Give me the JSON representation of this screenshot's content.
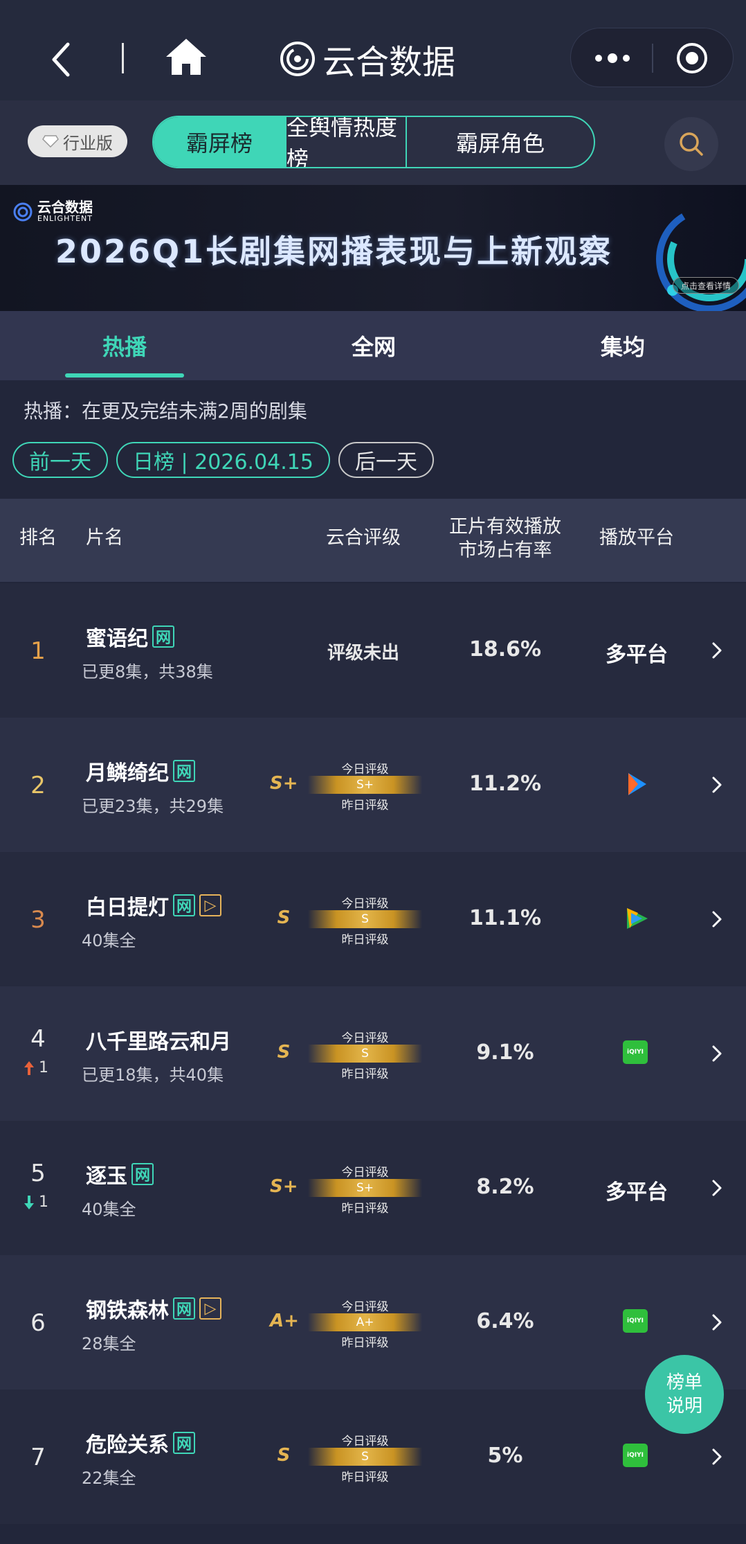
{
  "nav": {
    "brand": "云合数据"
  },
  "category": {
    "industry_label": "行业版",
    "tabs": [
      "霸屏榜",
      "全舆情热度榜",
      "霸屏角色"
    ]
  },
  "banner": {
    "logo_text": "云合数据",
    "logo_en": "ENLIGHTENT",
    "title": "2026Q1长剧集网播表现与上新观察",
    "button": "点击查看详情"
  },
  "tabs": [
    "热播",
    "全网",
    "集均"
  ],
  "description": "热播：在更及完结未满2周的剧集",
  "date_controls": {
    "prev": "前一天",
    "current": "日榜 | 2026.04.15",
    "next": "后一天"
  },
  "table": {
    "headers": {
      "rank": "排名",
      "title": "片名",
      "grade": "云合评级",
      "share_line1": "正片有效播放",
      "share_line2": "市场占有率",
      "platform": "播放平台"
    },
    "grade_top_label": "今日评级",
    "grade_bottom_label": "昨日评级",
    "rows": [
      {
        "rank": "1",
        "change": "",
        "title": "蜜语纪",
        "tags": [
          "网"
        ],
        "sub": "已更8集，共38集",
        "grade": "",
        "today_grade": "",
        "no_grade": "评级未出",
        "share": "18.6%",
        "platform_text": "多平台",
        "platform_icon": ""
      },
      {
        "rank": "2",
        "change": "",
        "title": "月鳞绮纪",
        "tags": [
          "网"
        ],
        "sub": "已更23集，共29集",
        "grade": "S+",
        "today_grade": "S+",
        "no_grade": "",
        "share": "11.2%",
        "platform_text": "",
        "platform_icon": "youku-icon"
      },
      {
        "rank": "3",
        "change": "",
        "title": "白日提灯",
        "tags": [
          "网",
          "▷"
        ],
        "sub": "40集全",
        "grade": "S",
        "today_grade": "S",
        "no_grade": "",
        "share": "11.1%",
        "platform_text": "",
        "platform_icon": "tencent-video-icon"
      },
      {
        "rank": "4",
        "change": "1",
        "change_dir": "up",
        "title": "八千里路云和月",
        "tags": [],
        "sub": "已更18集，共40集",
        "grade": "S",
        "today_grade": "S",
        "no_grade": "",
        "share": "9.1%",
        "platform_text": "",
        "platform_icon": "iqiyi-icon"
      },
      {
        "rank": "5",
        "change": "1",
        "change_dir": "down",
        "title": "逐玉",
        "tags": [
          "网"
        ],
        "sub": "40集全",
        "grade": "S+",
        "today_grade": "S+",
        "no_grade": "",
        "share": "8.2%",
        "platform_text": "多平台",
        "platform_icon": ""
      },
      {
        "rank": "6",
        "change": "",
        "title": "钢铁森林",
        "tags": [
          "网",
          "▷"
        ],
        "sub": "28集全",
        "grade": "A+",
        "today_grade": "A+",
        "no_grade": "",
        "share": "6.4%",
        "platform_text": "",
        "platform_icon": "iqiyi-icon"
      },
      {
        "rank": "7",
        "change": "",
        "title": "危险关系",
        "tags": [
          "网"
        ],
        "sub": "22集全",
        "grade": "S",
        "today_grade": "S",
        "no_grade": "",
        "share": "5%",
        "platform_text": "",
        "platform_icon": "iqiyi-icon"
      }
    ]
  },
  "iqiyi_label": "iQIYI",
  "float_button": {
    "line1": "榜单",
    "line2": "说明"
  },
  "colors": {
    "accent": "#3fd6b7",
    "gold": "#e5b552",
    "bg": "#22263a"
  }
}
